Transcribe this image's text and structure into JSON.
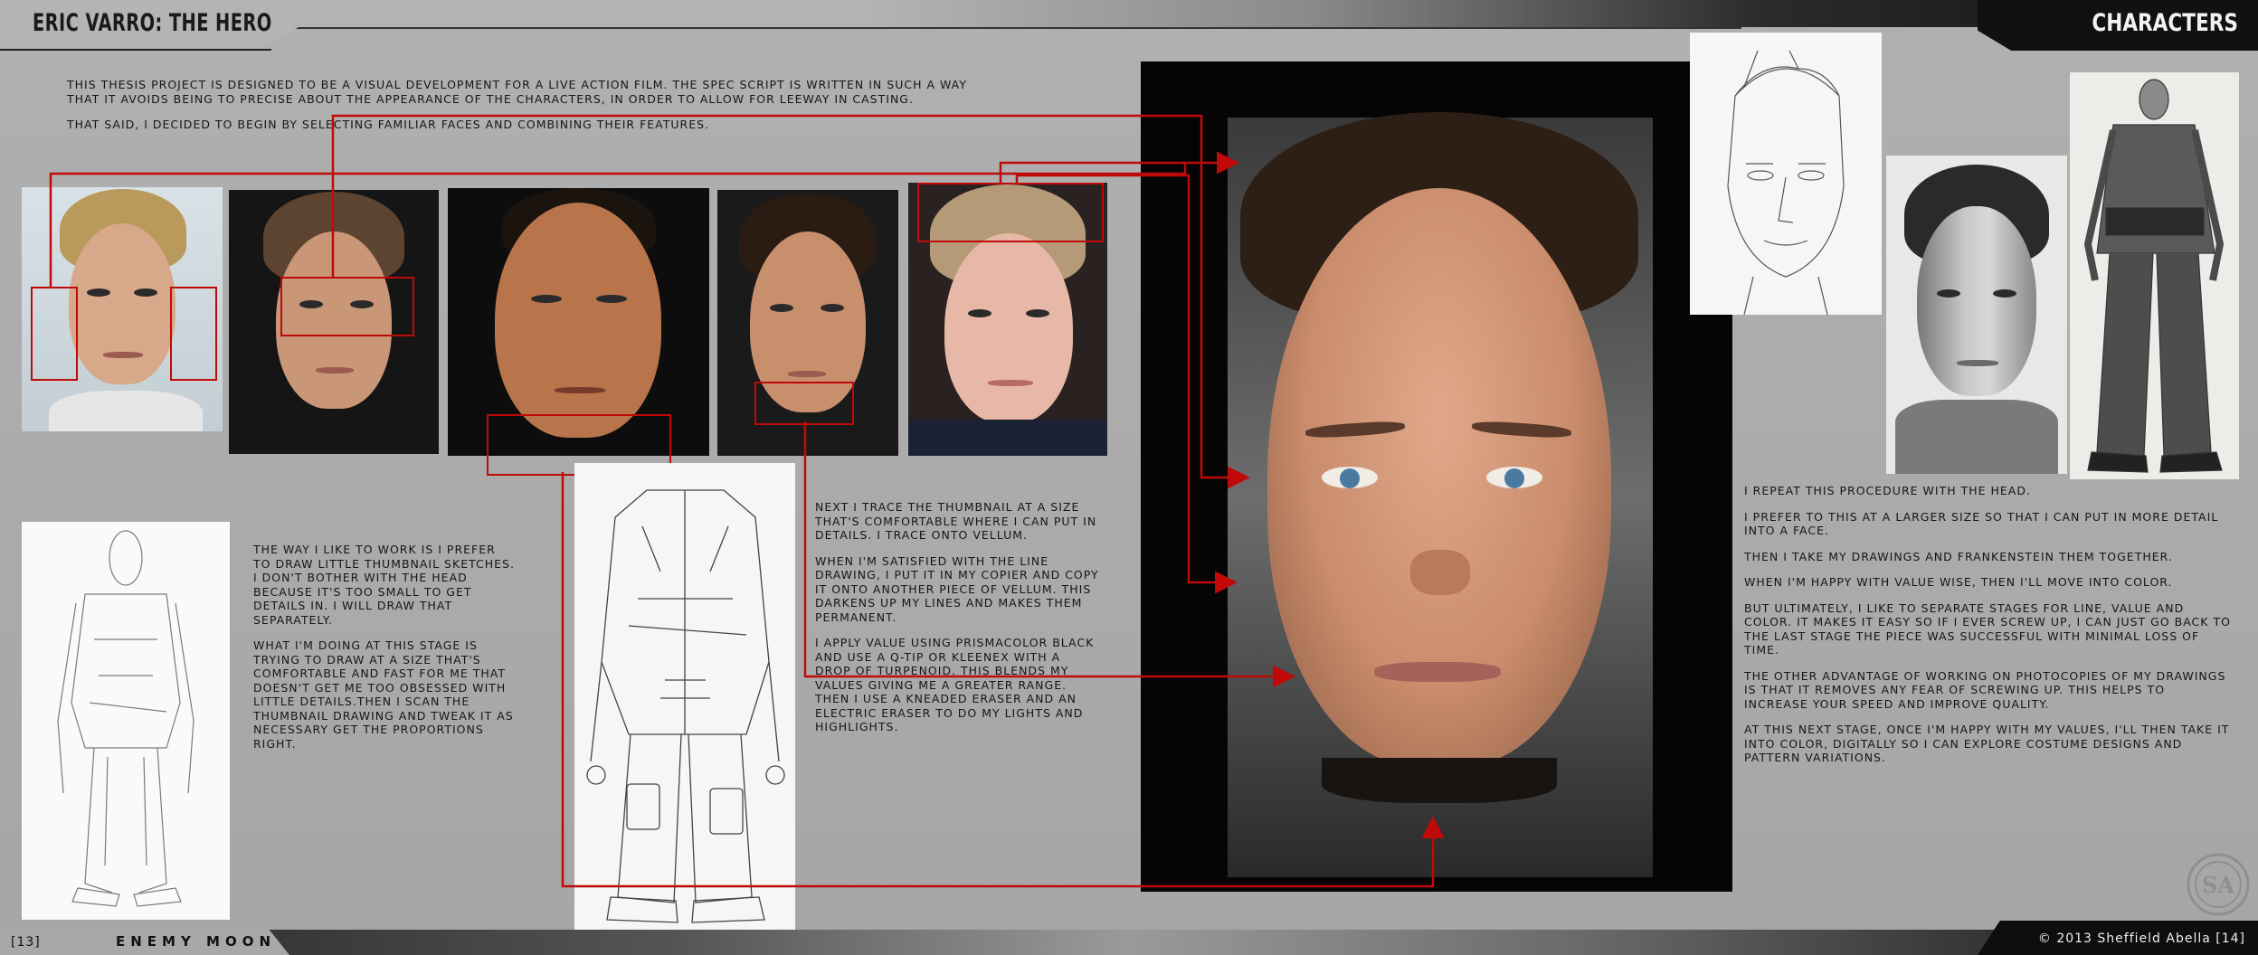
{
  "header": {
    "title_left": "ERIC VARRO: THE HERO",
    "title_right": "CHARACTERS"
  },
  "intro": {
    "para1": "This thesis project is designed to be a visual development for a live action film.  The spec script is written in such a way that it avoids being to precise about the appearance of the characters, in order to allow for leeway in casting.",
    "para2": "That said, I decided to begin by selecting familiar faces and combining their features."
  },
  "body_left": {
    "para1": "The way I like to work is I prefer to draw little thumbnail sketches.  I don't bother with the head because it's too small to get details in.  I will draw that separately.",
    "para2": "What I'm doing at this stage is trying to draw at a size that's comfortable and fast for me that doesn't get me too obsessed with little details.Then I scan the thumbnail drawing and tweak it as necessary get the proportions right."
  },
  "body_middle": {
    "para1": "Next I trace the thumbnail at a size that's comfortable where I can put in details.  I trace onto vellum.",
    "para2": "When I'm satisfied with the line drawing, I put it in my copier and copy it onto another piece of vellum.  This darkens up my lines and makes them permanent.",
    "para3": "I apply value using Prismacolor black and use a Q-tip or Kleenex with a drop of turpenoid.  This blends my values giving me a greater range.  Then I use a kneaded eraser and an electric eraser to do my lights and highlights."
  },
  "body_right": {
    "para1": "I repeat this procedure with the head.",
    "para2": "I prefer to this at a larger size so that I can put in more detail into a face.",
    "para3": "Then I take my drawings and Frankenstein them together.",
    "para4": "When I'm happy with value wise, then I'll move into color.",
    "para5": "But ultimately, I like to separate stages for line, value and color.  It makes it easy so if I ever screw up, I can just go back to the last stage the piece was successful with minimal loss of time.",
    "para6": "The other advantage of working on photocopies of my drawings is that it removes any fear of screwing up.  This helps to increase your speed and improve quality.",
    "para7": "At this next stage, once I'm happy with my values, I'll then take it into color, digitally so I can explore costume designs and pattern variations."
  },
  "footer": {
    "page_left": "[13]",
    "wordmark": "ENEMY MOON",
    "copyright": "© 2013 Sheffield Abella [14]"
  },
  "colors": {
    "accent_red": "#c00a0a",
    "background": "#a8a8a8",
    "text": "#161616"
  },
  "icons": {
    "seal": "sa-monogram-seal-icon",
    "arrow": "red-arrow-icon"
  }
}
